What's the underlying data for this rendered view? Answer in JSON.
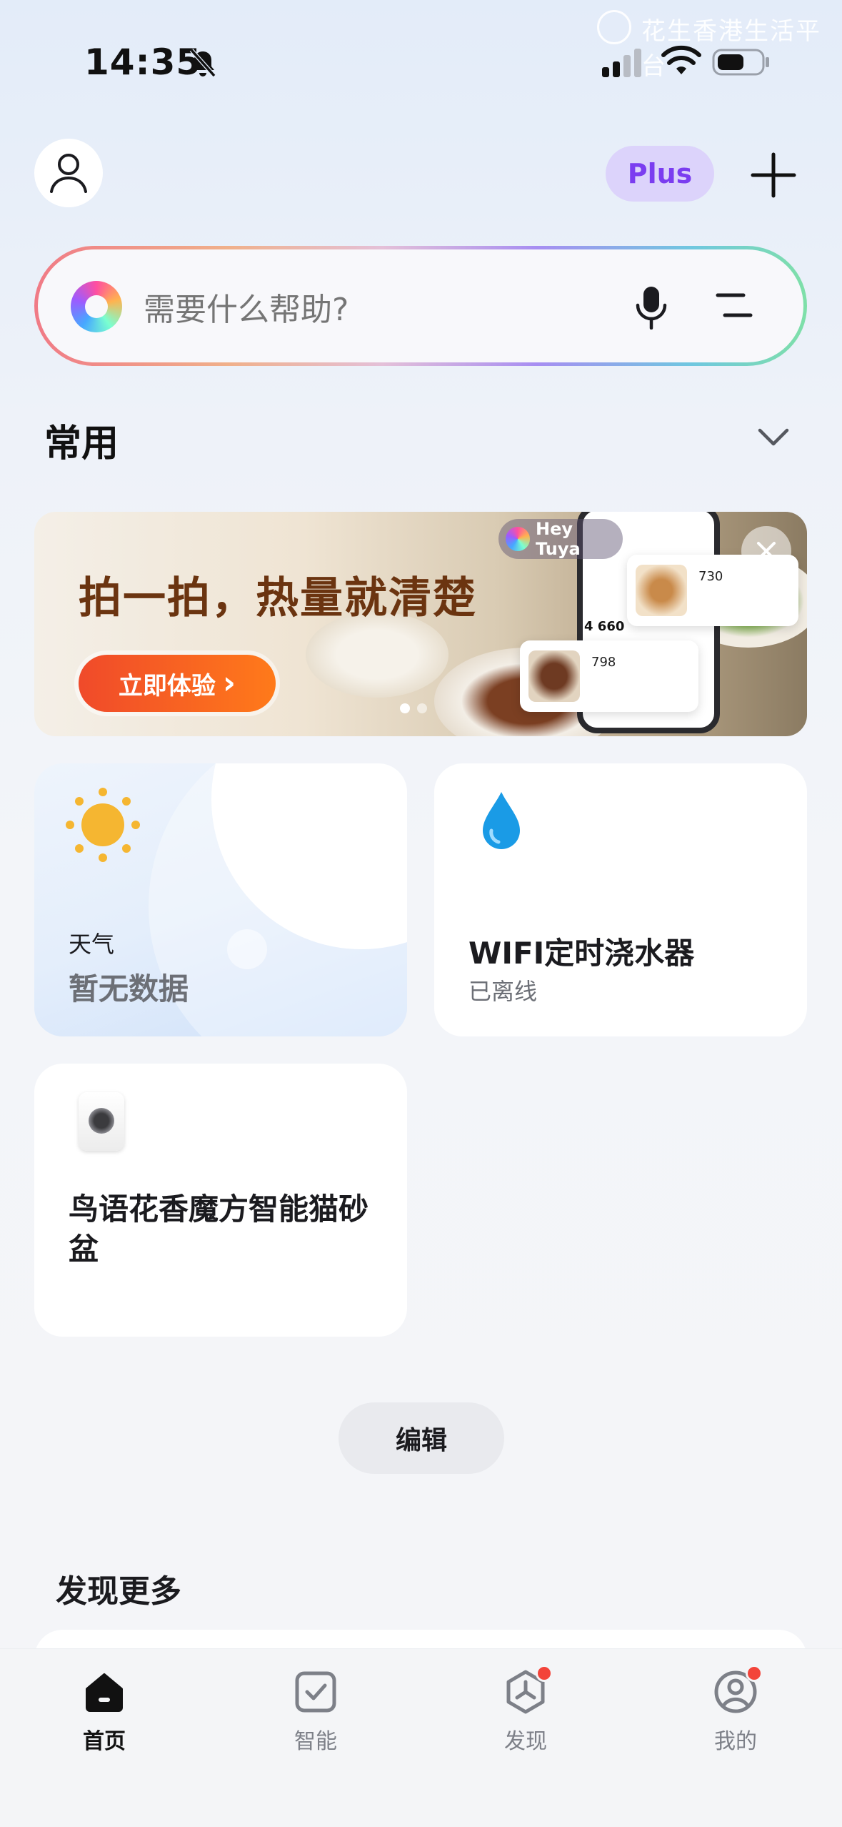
{
  "status_bar": {
    "time": "14:35"
  },
  "watermark": "花生香港生活平台",
  "header": {
    "plus_label": "Plus"
  },
  "search": {
    "placeholder": "需要什么帮助?"
  },
  "section": {
    "title": "常用"
  },
  "banner": {
    "title": "拍一拍，热量就清楚",
    "cta_label": "立即体验",
    "cta_arrow": "›",
    "badge_label": "Hey Tuya",
    "food_card_1": "730",
    "food_card_2": "798",
    "phone_stat": "4 660",
    "slide_count": 2,
    "active_slide": 1
  },
  "cards": {
    "weather": {
      "label": "天气",
      "value": "暂无数据"
    },
    "water": {
      "title": "WIFI定时浇水器",
      "status": "已离线"
    },
    "litter": {
      "title": "鸟语花香魔方智能猫砂盆"
    }
  },
  "edit_label": "编辑",
  "discover": {
    "title": "发现更多"
  },
  "tabbar": {
    "items": [
      {
        "label": "首页",
        "icon": "home-icon",
        "active": true,
        "badge": false
      },
      {
        "label": "智能",
        "icon": "check-square-icon",
        "active": false,
        "badge": false
      },
      {
        "label": "发现",
        "icon": "discover-icon",
        "active": false,
        "badge": true
      },
      {
        "label": "我的",
        "icon": "profile-icon",
        "active": false,
        "badge": true
      }
    ]
  },
  "colors": {
    "plus_accent": "#7b3df0",
    "banner_cta": "#f04a2a",
    "badge_red": "#f3443a",
    "drop_blue": "#1a9be6"
  }
}
